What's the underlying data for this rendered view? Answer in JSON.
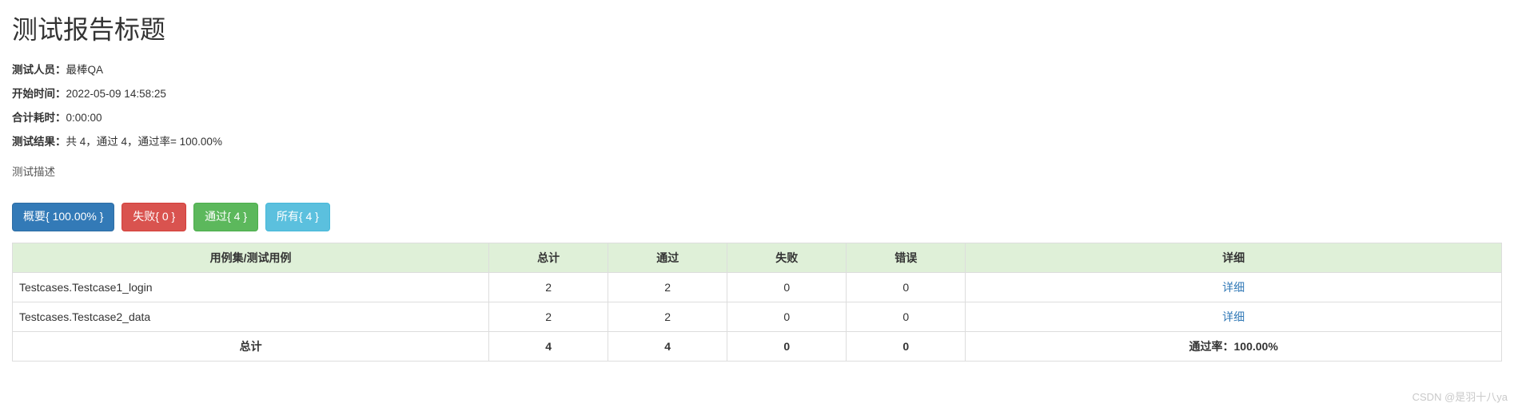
{
  "title": "测试报告标题",
  "meta": {
    "tester_label": "测试人员：",
    "tester_value": "最棒QA",
    "start_label": "开始时间：",
    "start_value": "2022-05-09 14:58:25",
    "duration_label": "合计耗时：",
    "duration_value": "0:00:00",
    "result_label": "测试结果：",
    "result_value": "共 4，通过 4，通过率= 100.00%"
  },
  "description": "测试描述",
  "buttons": {
    "summary": "概要{ 100.00% }",
    "fail": "失败{ 0 }",
    "pass": "通过{ 4 }",
    "all": "所有{ 4 }"
  },
  "table": {
    "headers": {
      "name": "用例集/测试用例",
      "total": "总计",
      "pass": "通过",
      "fail": "失败",
      "error": "错误",
      "detail": "详细"
    },
    "rows": [
      {
        "name": "Testcases.Testcase1_login",
        "total": "2",
        "pass": "2",
        "fail": "0",
        "error": "0",
        "detail": "详细"
      },
      {
        "name": "Testcases.Testcase2_data",
        "total": "2",
        "pass": "2",
        "fail": "0",
        "error": "0",
        "detail": "详细"
      }
    ],
    "footer": {
      "label": "总计",
      "total": "4",
      "pass": "4",
      "fail": "0",
      "error": "0",
      "rate_label": "通过率：",
      "rate_value": "100.00%"
    }
  },
  "watermark": "CSDN @是羽十八ya"
}
